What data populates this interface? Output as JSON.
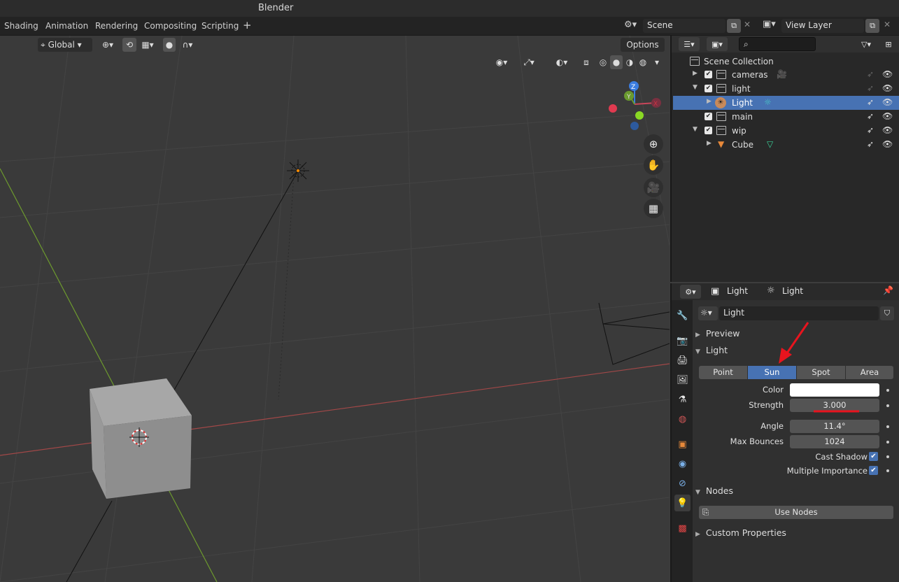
{
  "app": {
    "title": "Blender"
  },
  "workspace_tabs": [
    "Shading",
    "Animation",
    "Rendering",
    "Compositing",
    "Scripting",
    "+"
  ],
  "scene": {
    "name": "Scene"
  },
  "view_layer": {
    "name": "View Layer"
  },
  "viewport": {
    "orientation": "Global",
    "options_label": "Options",
    "gizmo": {
      "z": "Z",
      "y": "Y"
    }
  },
  "outliner": {
    "root": "Scene Collection",
    "rows": [
      {
        "label": "cameras",
        "depth": 1,
        "expanded": false,
        "selected": false
      },
      {
        "label": "light",
        "depth": 1,
        "expanded": true,
        "selected": false
      },
      {
        "label": "Light",
        "depth": 2,
        "expanded": false,
        "selected": true
      },
      {
        "label": "main",
        "depth": 1,
        "expanded": false,
        "selected": false
      },
      {
        "label": "wip",
        "depth": 1,
        "expanded": true,
        "selected": false
      },
      {
        "label": "Cube",
        "depth": 2,
        "expanded": false,
        "selected": false
      }
    ]
  },
  "properties": {
    "breadcrumb": {
      "object": "Light",
      "data": "Light"
    },
    "datablock": "Light",
    "sections": {
      "preview": "Preview",
      "light": "Light",
      "nodes": "Nodes",
      "custom": "Custom Properties"
    },
    "light_types": [
      "Point",
      "Sun",
      "Spot",
      "Area"
    ],
    "active_light_type": "Sun",
    "fields": {
      "color_label": "Color",
      "color_value": "#ffffff",
      "strength_label": "Strength",
      "strength": "3.000",
      "angle_label": "Angle",
      "angle": "11.4°",
      "bounces_label": "Max Bounces",
      "bounces": "1024",
      "cast_shadow_label": "Cast Shadow",
      "cast_shadow": true,
      "mis_label": "Multiple Importance",
      "mis": true
    },
    "use_nodes_label": "Use Nodes"
  },
  "colors": {
    "accent": "#4772b3",
    "annotation": "#e8141e",
    "x_axis": "#b24040",
    "y_axis": "#7aa23a"
  }
}
